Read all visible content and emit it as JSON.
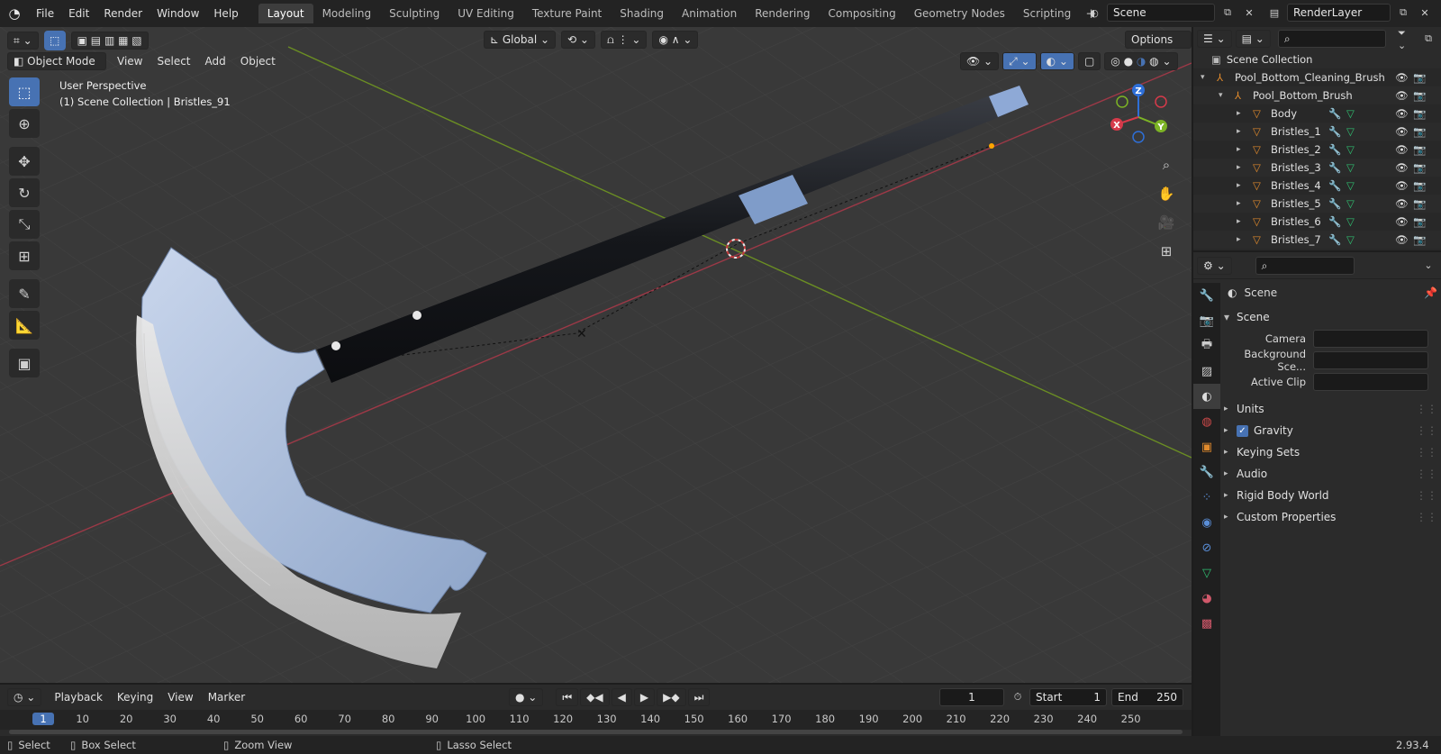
{
  "menu": [
    "File",
    "Edit",
    "Render",
    "Window",
    "Help"
  ],
  "workspaces": [
    {
      "label": "Layout",
      "active": true
    },
    {
      "label": "Modeling"
    },
    {
      "label": "Sculpting"
    },
    {
      "label": "UV Editing"
    },
    {
      "label": "Texture Paint"
    },
    {
      "label": "Shading"
    },
    {
      "label": "Animation"
    },
    {
      "label": "Rendering"
    },
    {
      "label": "Compositing"
    },
    {
      "label": "Geometry Nodes"
    },
    {
      "label": "Scripting"
    }
  ],
  "scene_selector": {
    "value": "Scene"
  },
  "view_layer": {
    "value": "RenderLayer"
  },
  "viewport": {
    "mode": "Object Mode",
    "menus": [
      "View",
      "Select",
      "Add",
      "Object"
    ],
    "transform_orientation": "Global",
    "options_label": "Options",
    "overlay_title": "User Perspective",
    "overlay_subtitle": "(1) Scene Collection | Bristles_91",
    "gizmo_axes": {
      "x": "X",
      "y": "Y",
      "z": "Z"
    }
  },
  "outliner": {
    "root": "Scene Collection",
    "items": [
      {
        "label": "Pool_Bottom_Cleaning_Brush",
        "type": "empty"
      },
      {
        "label": "Pool_Bottom_Brush",
        "type": "empty"
      },
      {
        "label": "Body",
        "type": "mesh"
      },
      {
        "label": "Bristles_1",
        "type": "mesh"
      },
      {
        "label": "Bristles_2",
        "type": "mesh"
      },
      {
        "label": "Bristles_3",
        "type": "mesh"
      },
      {
        "label": "Bristles_4",
        "type": "mesh"
      },
      {
        "label": "Bristles_5",
        "type": "mesh"
      },
      {
        "label": "Bristles_6",
        "type": "mesh"
      },
      {
        "label": "Bristles_7",
        "type": "mesh"
      }
    ]
  },
  "properties": {
    "context_label": "Scene",
    "panel_title": "Scene",
    "fields": [
      {
        "label": "Camera",
        "value": ""
      },
      {
        "label": "Background Sce...",
        "value": ""
      },
      {
        "label": "Active Clip",
        "value": ""
      }
    ],
    "subpanels": [
      "Units",
      "Gravity",
      "Keying Sets",
      "Audio",
      "Rigid Body World",
      "Custom Properties"
    ],
    "gravity_checked": true
  },
  "timeline": {
    "menus": [
      "Playback",
      "Keying",
      "View",
      "Marker"
    ],
    "current_frame": "1",
    "start_label": "Start",
    "start": "1",
    "end_label": "End",
    "end": "250",
    "ruler": [
      "1",
      "10",
      "20",
      "30",
      "40",
      "50",
      "60",
      "70",
      "80",
      "90",
      "100",
      "110",
      "120",
      "130",
      "140",
      "150",
      "160",
      "170",
      "180",
      "190",
      "200",
      "210",
      "220",
      "230",
      "240",
      "250"
    ]
  },
  "statusbar": {
    "items": [
      "Select",
      "Box Select",
      "Zoom View",
      "Lasso Select"
    ],
    "version": "2.93.4"
  },
  "colors": {
    "accent": "#4772b3",
    "axis_x": "#b3404f",
    "axis_y": "#6a8e23",
    "origin": "#ffa500"
  }
}
